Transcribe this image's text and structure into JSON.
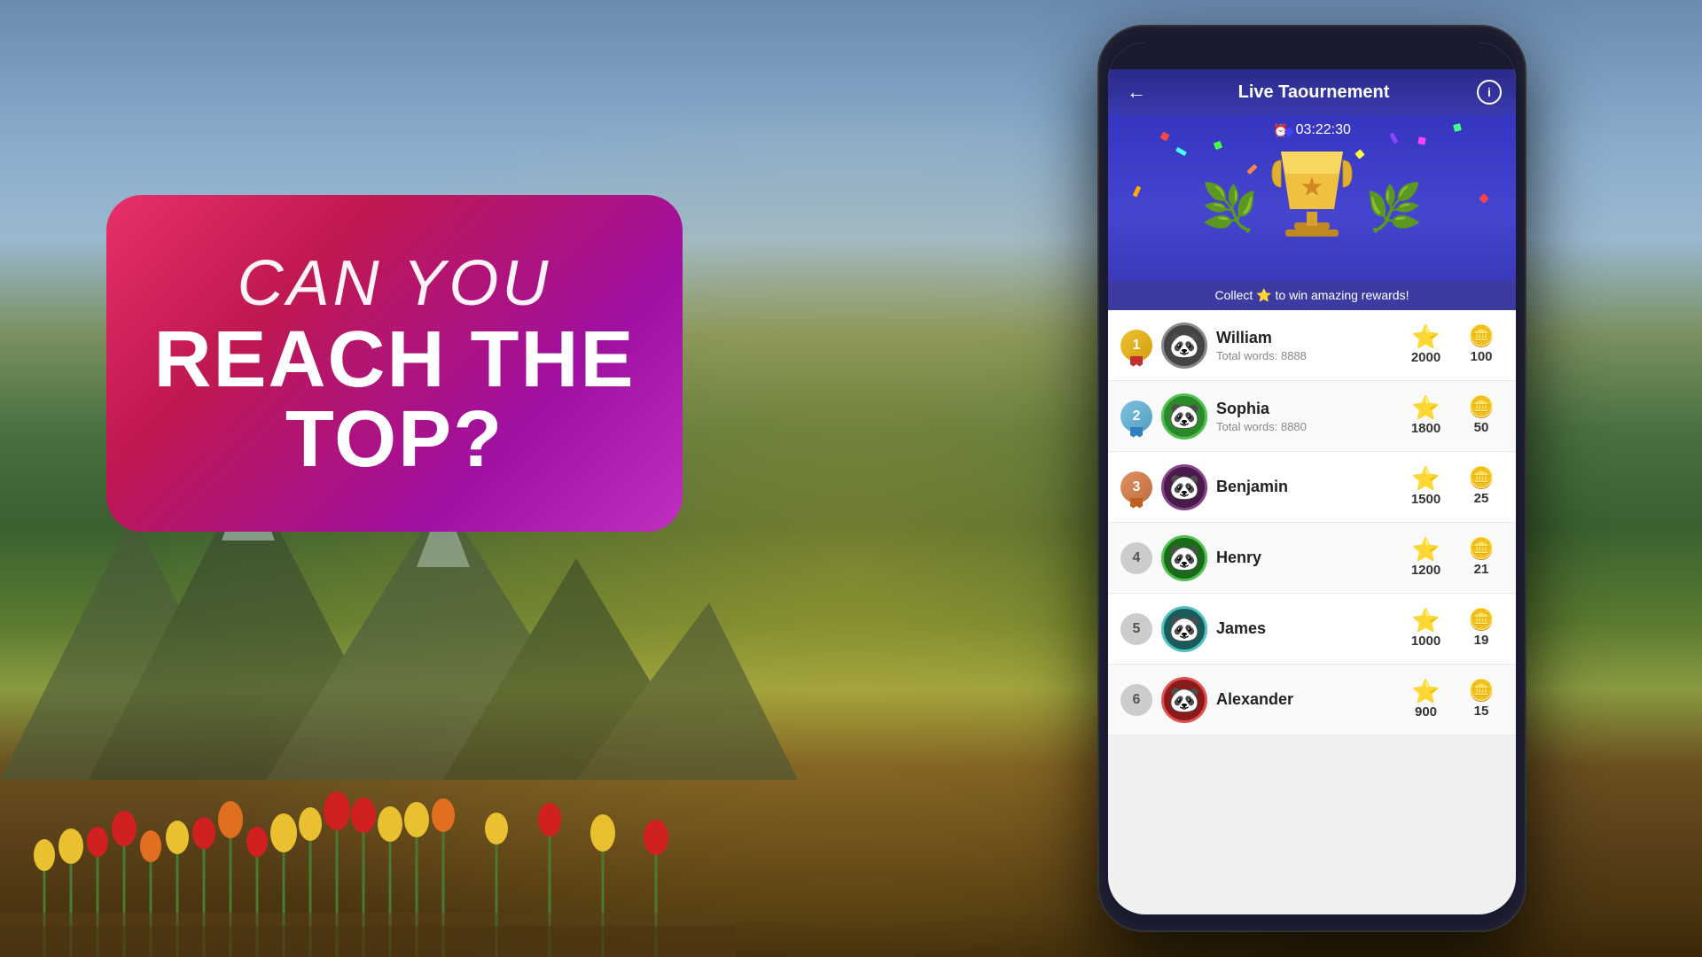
{
  "background": {
    "alt": "Tulip field with mountains background"
  },
  "left_panel": {
    "line1": "CAN YOU",
    "line2": "REACH THE",
    "line3": "TOP?"
  },
  "app": {
    "title": "Live Taournement",
    "back_label": "←",
    "info_label": "i",
    "timer": "03:22:30",
    "collect_text": "Collect ⭐ to win amazing rewards!",
    "leaderboard": [
      {
        "rank": 1,
        "name": "William",
        "words_label": "Total words: 8888",
        "score": 2000,
        "coins": 100
      },
      {
        "rank": 2,
        "name": "Sophia",
        "words_label": "Total words: 8880",
        "score": 1800,
        "coins": 50
      },
      {
        "rank": 3,
        "name": "Benjamin",
        "words_label": "",
        "score": 1500,
        "coins": 25
      },
      {
        "rank": 4,
        "name": "Henry",
        "words_label": "",
        "score": 1200,
        "coins": 21
      },
      {
        "rank": 5,
        "name": "James",
        "words_label": "",
        "score": 1000,
        "coins": 19
      },
      {
        "rank": 6,
        "name": "Alexander",
        "words_label": "",
        "score": 900,
        "coins": 15
      }
    ]
  }
}
